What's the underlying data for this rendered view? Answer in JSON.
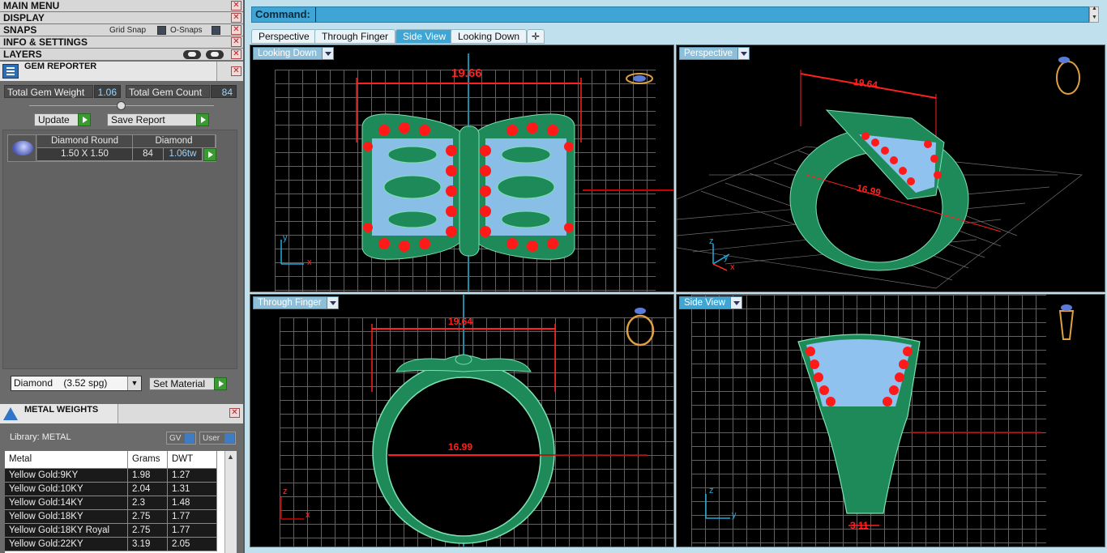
{
  "left_panel": {
    "menus": {
      "main_menu": "MAIN MENU",
      "display": "DISPLAY",
      "snaps": "SNAPS",
      "grid_snap": "Grid Snap",
      "o_snaps": "O-Snaps",
      "info_settings": "INFO & SETTINGS",
      "layers": "LAYERS"
    },
    "gem_reporter": {
      "title": "GEM REPORTER",
      "total_weight_label": "Total Gem Weight",
      "total_weight_value": "1.06",
      "total_count_label": "Total Gem Count",
      "total_count_value": "84",
      "update_label": "Update",
      "save_report_label": "Save Report",
      "row": {
        "cut": "Diamond Round",
        "material": "Diamond",
        "size": "1.50 X 1.50",
        "count": "84",
        "weight": "1.06tw"
      },
      "material_select": "Diamond    (3.52 spg)",
      "set_material_label": "Set Material"
    },
    "metal_weights": {
      "title": "METAL WEIGHTS",
      "library_label": "Library: METAL",
      "gv_label": "GV",
      "user_label": "User",
      "columns": [
        "Metal",
        "Grams",
        "DWT"
      ],
      "rows": [
        [
          "Yellow Gold:9KY",
          "1.98",
          "1.27"
        ],
        [
          "Yellow Gold:10KY",
          "2.04",
          "1.31"
        ],
        [
          "Yellow Gold:14KY",
          "2.3",
          "1.48"
        ],
        [
          "Yellow Gold:18KY",
          "2.75",
          "1.77"
        ],
        [
          "Yellow Gold:18KY Royal",
          "2.75",
          "1.77"
        ],
        [
          "Yellow Gold:22KY",
          "3.19",
          "2.05"
        ]
      ]
    }
  },
  "command": {
    "label": "Command:"
  },
  "tabs": [
    "Perspective",
    "Through Finger",
    "Side View",
    "Looking Down"
  ],
  "active_tab": "Side View",
  "viewports": {
    "top_left": {
      "label": "Looking Down",
      "dimension": "19.66",
      "axis_a": "y",
      "axis_b": "x"
    },
    "top_right": {
      "label": "Perspective",
      "dimension_a": "19.64",
      "dimension_b": "16.99",
      "axis_a": "z",
      "axis_b": "y",
      "axis_c": "x"
    },
    "bottom_left": {
      "label": "Through Finger",
      "dimension_a": "19.64",
      "dimension_b": "16.99",
      "axis_a": "z",
      "axis_b": "x"
    },
    "bottom_right": {
      "label": "Side View",
      "dimension": "3.11",
      "axis_a": "z",
      "axis_b": "y"
    }
  },
  "colors": {
    "metal": "#1f8a5a",
    "gem_red": "#ff1a1a",
    "gem_blue": "#9cc8ff",
    "accent": "#3ea5d4",
    "dim_line": "#ff2020"
  }
}
